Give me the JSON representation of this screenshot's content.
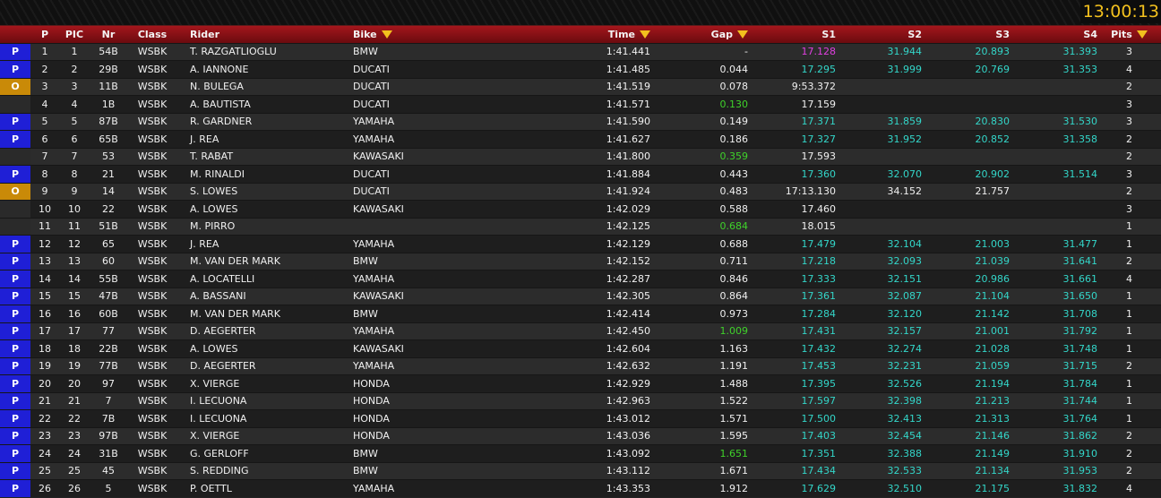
{
  "clock": "13:00:13",
  "headers": {
    "p": "P",
    "pic": "PIC",
    "nr": "Nr",
    "class": "Class",
    "rider": "Rider",
    "bike": "Bike",
    "time": "Time",
    "gap": "Gap",
    "s1": "S1",
    "s2": "S2",
    "s3": "S3",
    "s4": "S4",
    "pits": "Pits"
  },
  "colors": {
    "pit_flag": "#1f1fd6",
    "out_flag": "#c98a08",
    "best_sector": "#e040e0",
    "personal_best": "#3fd22a",
    "sector": "#33d6c9",
    "clock": "#f2c01e",
    "header": "#a4161c"
  },
  "rows": [
    {
      "flag": "P",
      "p": "1",
      "pic": "1",
      "nr": "54B",
      "cls": "WSBK",
      "rider": "T. RAZGATLIOGLU",
      "bike": "BMW",
      "time": "1:41.441",
      "gap": "-",
      "gap_c": "white",
      "s1": "17.128",
      "s1_c": "magenta",
      "s2": "31.944",
      "s3": "20.893",
      "s4": "31.393",
      "pits": "3"
    },
    {
      "flag": "P",
      "p": "2",
      "pic": "2",
      "nr": "29B",
      "cls": "WSBK",
      "rider": "A. IANNONE",
      "bike": "DUCATI",
      "time": "1:41.485",
      "gap": "0.044",
      "gap_c": "white",
      "s1": "17.295",
      "s1_c": "cyan",
      "s2": "31.999",
      "s3": "20.769",
      "s4": "31.353",
      "pits": "4"
    },
    {
      "flag": "O",
      "p": "3",
      "pic": "3",
      "nr": "11B",
      "cls": "WSBK",
      "rider": "N. BULEGA",
      "bike": "DUCATI",
      "time": "1:41.519",
      "gap": "0.078",
      "gap_c": "white",
      "s1": "9:53.372",
      "s1_c": "white",
      "s2": "",
      "s3": "",
      "s4": "",
      "pits": "2"
    },
    {
      "flag": "",
      "p": "4",
      "pic": "4",
      "nr": "1B",
      "cls": "WSBK",
      "rider": "A. BAUTISTA",
      "bike": "DUCATI",
      "time": "1:41.571",
      "gap": "0.130",
      "gap_c": "green",
      "s1": "17.159",
      "s1_c": "white",
      "s2": "",
      "s3": "",
      "s4": "",
      "pits": "3"
    },
    {
      "flag": "P",
      "p": "5",
      "pic": "5",
      "nr": "87B",
      "cls": "WSBK",
      "rider": "R. GARDNER",
      "bike": "YAMAHA",
      "time": "1:41.590",
      "gap": "0.149",
      "gap_c": "white",
      "s1": "17.371",
      "s1_c": "cyan",
      "s2": "31.859",
      "s3": "20.830",
      "s4": "31.530",
      "pits": "3"
    },
    {
      "flag": "P",
      "p": "6",
      "pic": "6",
      "nr": "65B",
      "cls": "WSBK",
      "rider": "J. REA",
      "bike": "YAMAHA",
      "time": "1:41.627",
      "gap": "0.186",
      "gap_c": "white",
      "s1": "17.327",
      "s1_c": "cyan",
      "s2": "31.952",
      "s3": "20.852",
      "s4": "31.358",
      "pits": "2"
    },
    {
      "flag": "",
      "p": "7",
      "pic": "7",
      "nr": "53",
      "cls": "WSBK",
      "rider": "T. RABAT",
      "bike": "KAWASAKI",
      "time": "1:41.800",
      "gap": "0.359",
      "gap_c": "green",
      "s1": "17.593",
      "s1_c": "white",
      "s2": "",
      "s3": "",
      "s4": "",
      "pits": "2"
    },
    {
      "flag": "P",
      "p": "8",
      "pic": "8",
      "nr": "21",
      "cls": "WSBK",
      "rider": "M. RINALDI",
      "bike": "DUCATI",
      "time": "1:41.884",
      "gap": "0.443",
      "gap_c": "white",
      "s1": "17.360",
      "s1_c": "cyan",
      "s2": "32.070",
      "s3": "20.902",
      "s4": "31.514",
      "pits": "3"
    },
    {
      "flag": "O",
      "p": "9",
      "pic": "9",
      "nr": "14",
      "cls": "WSBK",
      "rider": "S. LOWES",
      "bike": "DUCATI",
      "time": "1:41.924",
      "gap": "0.483",
      "gap_c": "white",
      "s1": "17:13.130",
      "s1_c": "white",
      "s2": "34.152",
      "s2_c": "white",
      "s3": "21.757",
      "s3_c": "white",
      "s4": "",
      "pits": "2"
    },
    {
      "flag": "",
      "p": "10",
      "pic": "10",
      "nr": "22",
      "cls": "WSBK",
      "rider": "A. LOWES",
      "bike": "KAWASAKI",
      "time": "1:42.029",
      "gap": "0.588",
      "gap_c": "white",
      "s1": "17.460",
      "s1_c": "white",
      "s2": "",
      "s3": "",
      "s4": "",
      "pits": "3"
    },
    {
      "flag": "",
      "p": "11",
      "pic": "11",
      "nr": "51B",
      "cls": "WSBK",
      "rider": "M. PIRRO",
      "bike": "",
      "time": "1:42.125",
      "gap": "0.684",
      "gap_c": "green",
      "s1": "18.015",
      "s1_c": "white",
      "s2": "",
      "s3": "",
      "s4": "",
      "pits": "1"
    },
    {
      "flag": "P",
      "p": "12",
      "pic": "12",
      "nr": "65",
      "cls": "WSBK",
      "rider": "J. REA",
      "bike": "YAMAHA",
      "time": "1:42.129",
      "gap": "0.688",
      "gap_c": "white",
      "s1": "17.479",
      "s1_c": "cyan",
      "s2": "32.104",
      "s3": "21.003",
      "s4": "31.477",
      "pits": "1"
    },
    {
      "flag": "P",
      "p": "13",
      "pic": "13",
      "nr": "60",
      "cls": "WSBK",
      "rider": "M. VAN DER MARK",
      "bike": "BMW",
      "time": "1:42.152",
      "gap": "0.711",
      "gap_c": "white",
      "s1": "17.218",
      "s1_c": "cyan",
      "s2": "32.093",
      "s3": "21.039",
      "s4": "31.641",
      "pits": "2"
    },
    {
      "flag": "P",
      "p": "14",
      "pic": "14",
      "nr": "55B",
      "cls": "WSBK",
      "rider": "A. LOCATELLI",
      "bike": "YAMAHA",
      "time": "1:42.287",
      "gap": "0.846",
      "gap_c": "white",
      "s1": "17.333",
      "s1_c": "cyan",
      "s2": "32.151",
      "s3": "20.986",
      "s4": "31.661",
      "pits": "4"
    },
    {
      "flag": "P",
      "p": "15",
      "pic": "15",
      "nr": "47B",
      "cls": "WSBK",
      "rider": "A. BASSANI",
      "bike": "KAWASAKI",
      "time": "1:42.305",
      "gap": "0.864",
      "gap_c": "white",
      "s1": "17.361",
      "s1_c": "cyan",
      "s2": "32.087",
      "s3": "21.104",
      "s4": "31.650",
      "pits": "1"
    },
    {
      "flag": "P",
      "p": "16",
      "pic": "16",
      "nr": "60B",
      "cls": "WSBK",
      "rider": "M. VAN DER MARK",
      "bike": "BMW",
      "time": "1:42.414",
      "gap": "0.973",
      "gap_c": "white",
      "s1": "17.284",
      "s1_c": "cyan",
      "s2": "32.120",
      "s3": "21.142",
      "s4": "31.708",
      "pits": "1"
    },
    {
      "flag": "P",
      "p": "17",
      "pic": "17",
      "nr": "77",
      "cls": "WSBK",
      "rider": "D. AEGERTER",
      "bike": "YAMAHA",
      "time": "1:42.450",
      "gap": "1.009",
      "gap_c": "green",
      "s1": "17.431",
      "s1_c": "cyan",
      "s2": "32.157",
      "s3": "21.001",
      "s4": "31.792",
      "pits": "1"
    },
    {
      "flag": "P",
      "p": "18",
      "pic": "18",
      "nr": "22B",
      "cls": "WSBK",
      "rider": "A. LOWES",
      "bike": "KAWASAKI",
      "time": "1:42.604",
      "gap": "1.163",
      "gap_c": "white",
      "s1": "17.432",
      "s1_c": "cyan",
      "s2": "32.274",
      "s3": "21.028",
      "s4": "31.748",
      "pits": "1"
    },
    {
      "flag": "P",
      "p": "19",
      "pic": "19",
      "nr": "77B",
      "cls": "WSBK",
      "rider": "D. AEGERTER",
      "bike": "YAMAHA",
      "time": "1:42.632",
      "gap": "1.191",
      "gap_c": "white",
      "s1": "17.453",
      "s1_c": "cyan",
      "s2": "32.231",
      "s3": "21.059",
      "s4": "31.715",
      "pits": "2"
    },
    {
      "flag": "P",
      "p": "20",
      "pic": "20",
      "nr": "97",
      "cls": "WSBK",
      "rider": "X. VIERGE",
      "bike": "HONDA",
      "time": "1:42.929",
      "gap": "1.488",
      "gap_c": "white",
      "s1": "17.395",
      "s1_c": "cyan",
      "s2": "32.526",
      "s3": "21.194",
      "s4": "31.784",
      "pits": "1"
    },
    {
      "flag": "P",
      "p": "21",
      "pic": "21",
      "nr": "7",
      "cls": "WSBK",
      "rider": "I. LECUONA",
      "bike": "HONDA",
      "time": "1:42.963",
      "gap": "1.522",
      "gap_c": "white",
      "s1": "17.597",
      "s1_c": "cyan",
      "s2": "32.398",
      "s3": "21.213",
      "s4": "31.744",
      "pits": "1"
    },
    {
      "flag": "P",
      "p": "22",
      "pic": "22",
      "nr": "7B",
      "cls": "WSBK",
      "rider": "I. LECUONA",
      "bike": "HONDA",
      "time": "1:43.012",
      "gap": "1.571",
      "gap_c": "white",
      "s1": "17.500",
      "s1_c": "cyan",
      "s2": "32.413",
      "s3": "21.313",
      "s4": "31.764",
      "pits": "1"
    },
    {
      "flag": "P",
      "p": "23",
      "pic": "23",
      "nr": "97B",
      "cls": "WSBK",
      "rider": "X. VIERGE",
      "bike": "HONDA",
      "time": "1:43.036",
      "gap": "1.595",
      "gap_c": "white",
      "s1": "17.403",
      "s1_c": "cyan",
      "s2": "32.454",
      "s3": "21.146",
      "s4": "31.862",
      "pits": "2"
    },
    {
      "flag": "P",
      "p": "24",
      "pic": "24",
      "nr": "31B",
      "cls": "WSBK",
      "rider": "G. GERLOFF",
      "bike": "BMW",
      "time": "1:43.092",
      "gap": "1.651",
      "gap_c": "green",
      "s1": "17.351",
      "s1_c": "cyan",
      "s2": "32.388",
      "s3": "21.149",
      "s4": "31.910",
      "pits": "2"
    },
    {
      "flag": "P",
      "p": "25",
      "pic": "25",
      "nr": "45",
      "cls": "WSBK",
      "rider": "S. REDDING",
      "bike": "BMW",
      "time": "1:43.112",
      "gap": "1.671",
      "gap_c": "white",
      "s1": "17.434",
      "s1_c": "cyan",
      "s2": "32.533",
      "s3": "21.134",
      "s4": "31.953",
      "pits": "2"
    },
    {
      "flag": "P",
      "p": "26",
      "pic": "26",
      "nr": "5",
      "cls": "WSBK",
      "rider": "P. OETTL",
      "bike": "YAMAHA",
      "time": "1:43.353",
      "gap": "1.912",
      "gap_c": "white",
      "s1": "17.629",
      "s1_c": "cyan",
      "s2": "32.510",
      "s3": "21.175",
      "s4": "31.832",
      "pits": "4"
    }
  ]
}
